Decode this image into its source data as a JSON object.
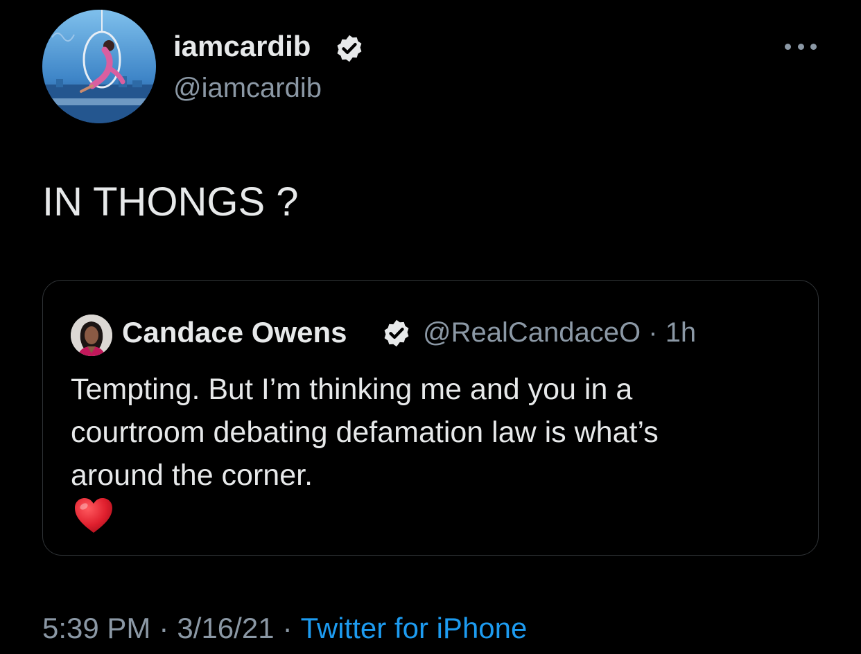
{
  "author": {
    "name": "iamcardib",
    "handle": "@iamcardib",
    "verified": true
  },
  "tweet": {
    "text": "IN THONGS ?"
  },
  "quoted_tweet": {
    "name": "Candace Owens",
    "handle": "@RealCandaceO",
    "separator": "·",
    "age": "1h",
    "text_lines": [
      "Tempting. But I’m thinking me and you in a",
      "courtroom debating defamation law is what’s",
      "around the corner."
    ],
    "emoji": "heart-emoji"
  },
  "footer": {
    "time": "5:39 PM",
    "separator": "·",
    "date": "3/16/21",
    "source": "Twitter for iPhone"
  },
  "colors": {
    "background": "#000000",
    "primary_text": "#e7e9ea",
    "secondary_text": "#8b98a5",
    "link": "#1d9bf0",
    "border": "#2f3336",
    "heart": "#e0202e"
  },
  "icons": [
    "verified-badge-icon",
    "more-options-icon",
    "heart-icon"
  ]
}
